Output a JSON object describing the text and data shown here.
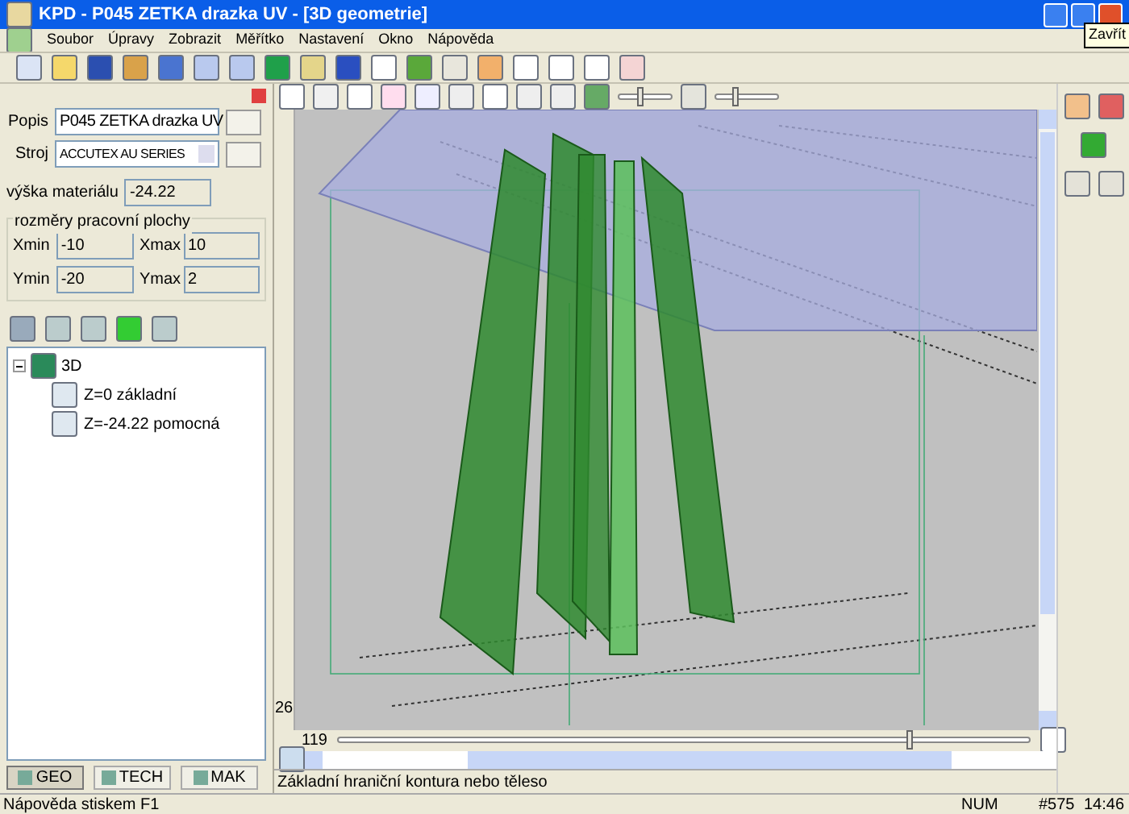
{
  "window": {
    "title": "KPD - P045 ZETKA drazka UV - [3D geometrie]",
    "tooltip": "Zavřít"
  },
  "menu": [
    {
      "label": "Soubor"
    },
    {
      "label": "Úpravy"
    },
    {
      "label": "Zobrazit"
    },
    {
      "label": "Měřítko"
    },
    {
      "label": "Nastavení"
    },
    {
      "label": "Okno"
    },
    {
      "label": "Nápověda"
    }
  ],
  "left_panel": {
    "fields": [
      {
        "label": "Popis",
        "value": "P045 ZETKA drazka UV",
        "kind": "text"
      },
      {
        "label": "Stroj",
        "value": "ACCUTEX AU SERIES",
        "kind": "select"
      }
    ],
    "material_height": {
      "label": "výška materiálu",
      "value": "-24.22"
    },
    "work_area": {
      "title": "rozměry pracovní plochy",
      "fields": [
        {
          "label": "Xmin",
          "value": "-10"
        },
        {
          "label": "Xmax",
          "value": "10"
        },
        {
          "label": "Ymin",
          "value": "-20"
        },
        {
          "label": "Ymax",
          "value": "2"
        }
      ]
    },
    "tree": [
      {
        "label": "3D",
        "expanded": true,
        "children": [
          {
            "label": "Z=0 základní"
          },
          {
            "label": "Z=-24.22 pomocná"
          }
        ]
      }
    ],
    "tabs": [
      {
        "label": "GEO",
        "selected": true
      },
      {
        "label": "TECH",
        "selected": false
      },
      {
        "label": "MAK",
        "selected": false
      }
    ]
  },
  "viewport": {
    "sliders": [
      {
        "level": 0.4
      },
      {
        "level": 0.3
      }
    ],
    "ruler_vertical": "26",
    "ruler_horizontal": "119",
    "ruler_slider": {
      "level": 0.83
    },
    "hint": "Základní hraniční kontura nebo těleso"
  },
  "status_bar": {
    "help": "Nápověda stiskem F1",
    "num": "NUM",
    "record": "#575",
    "time": "14:46"
  }
}
